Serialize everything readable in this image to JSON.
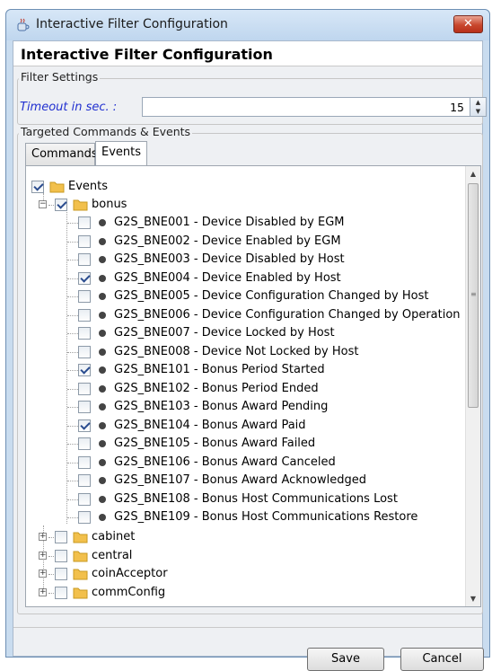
{
  "window": {
    "title": "Interactive Filter Configuration",
    "close_glyph": "✕",
    "header_title": "Interactive Filter Configuration"
  },
  "filter_settings": {
    "group_label": "Filter Settings",
    "timeout_label": "Timeout in sec. :",
    "timeout_value": "15"
  },
  "targeted": {
    "group_label": "Targeted Commands & Events",
    "tabs": [
      {
        "label": "Commands",
        "active": false
      },
      {
        "label": "Events",
        "active": true
      }
    ]
  },
  "tree": {
    "root": {
      "label": "Events",
      "checked": true
    },
    "bonus": {
      "label": "bonus",
      "checked": true,
      "expanded": true
    },
    "bonus_events": [
      {
        "label": "G2S_BNE001 - Device Disabled by EGM",
        "checked": false
      },
      {
        "label": "G2S_BNE002 - Device Enabled by EGM",
        "checked": false
      },
      {
        "label": "G2S_BNE003 - Device Disabled by Host",
        "checked": false
      },
      {
        "label": "G2S_BNE004 - Device Enabled by Host",
        "checked": true
      },
      {
        "label": "G2S_BNE005 - Device Configuration Changed by Host",
        "checked": false
      },
      {
        "label": "G2S_BNE006 - Device Configuration Changed by Operation",
        "checked": false
      },
      {
        "label": "G2S_BNE007 - Device Locked by Host",
        "checked": false
      },
      {
        "label": "G2S_BNE008 - Device Not Locked by Host",
        "checked": false
      },
      {
        "label": "G2S_BNE101 - Bonus Period Started",
        "checked": true
      },
      {
        "label": "G2S_BNE102 - Bonus Period Ended",
        "checked": false
      },
      {
        "label": "G2S_BNE103 - Bonus Award Pending",
        "checked": false
      },
      {
        "label": "G2S_BNE104 - Bonus Award Paid",
        "checked": true
      },
      {
        "label": "G2S_BNE105 - Bonus Award Failed",
        "checked": false
      },
      {
        "label": "G2S_BNE106 - Bonus Award Canceled",
        "checked": false
      },
      {
        "label": "G2S_BNE107 - Bonus Award Acknowledged",
        "checked": false
      },
      {
        "label": "G2S_BNE108 - Bonus Host Communications Lost",
        "checked": false
      },
      {
        "label": "G2S_BNE109 - Bonus Host Communications Restore",
        "checked": false
      }
    ],
    "collapsed_folders": [
      {
        "label": "cabinet",
        "checked": false
      },
      {
        "label": "central",
        "checked": false
      },
      {
        "label": "coinAcceptor",
        "checked": false
      },
      {
        "label": "commConfig",
        "checked": false
      }
    ]
  },
  "buttons": {
    "save": "Save",
    "cancel": "Cancel"
  },
  "colors": {
    "timeout_label": "#2130d0",
    "checkmark": "#2a4c8f",
    "folder": "#f2c04c"
  },
  "icons": {
    "window_icon": "java-cup-icon",
    "folder_icon": "folder-icon",
    "event_icon": "bullet-icon",
    "expander_collapsed": "plus-box-icon",
    "expander_expanded": "minus-box-icon"
  }
}
